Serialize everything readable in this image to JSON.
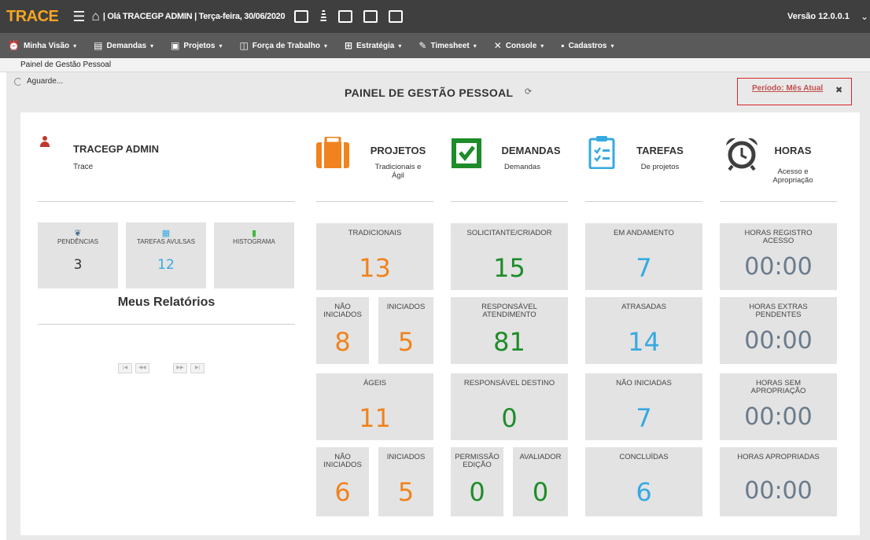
{
  "header": {
    "logo": "TRACE",
    "greeting": "| Olá  TRACEGP ADMIN | Terça-feira, 30/06/2020",
    "version": "Versão 12.0.0.1"
  },
  "nav": {
    "items": [
      {
        "label": "Minha Visão",
        "icon": "clock-icon"
      },
      {
        "label": "Demandas",
        "icon": "document-icon"
      },
      {
        "label": "Projetos",
        "icon": "briefcase-icon"
      },
      {
        "label": "Força de Trabalho",
        "icon": "chart-icon"
      },
      {
        "label": "Estratégia",
        "icon": "hierarchy-icon"
      },
      {
        "label": "Timesheet",
        "icon": "pencil-icon"
      },
      {
        "label": "Console",
        "icon": "tools-icon"
      },
      {
        "label": "Cadastros",
        "icon": "book-icon"
      }
    ]
  },
  "breadcrumb": "Painel de Gestão Pessoal",
  "status": "Aguarde...",
  "page_title": "PAINEL DE GESTÃO PESSOAL",
  "periodo": "Período: Mês Atual",
  "user": {
    "name": "TRACEGP ADMIN",
    "org": "Trace"
  },
  "categories": [
    {
      "title": "PROJETOS",
      "sub1": "Tradicionais e",
      "sub2": "Ágil",
      "color": "#f0831e"
    },
    {
      "title": "DEMANDAS",
      "sub1": "Demandas",
      "sub2": "",
      "color": "#1e8c2a"
    },
    {
      "title": "TAREFAS",
      "sub1": "De projetos",
      "sub2": "",
      "color": "#36a9e1"
    },
    {
      "title": "HORAS",
      "sub1": "Acesso e",
      "sub2": "Apropriação",
      "color": "#3f3f3f"
    }
  ],
  "mini": {
    "pendencias": {
      "label": "PENDÊNCIAS",
      "value": "3"
    },
    "tarefas_avulsas": {
      "label": "TAREFAS AVULSAS",
      "value": "12"
    },
    "histograma": {
      "label": "HISTOGRAMA"
    }
  },
  "relatorios": {
    "title": "Meus Relatórios",
    "pager": [
      "|◀",
      "◀◀",
      "▶▶",
      "▶|"
    ]
  },
  "projetos": {
    "tradicionais": {
      "label": "TRADICIONAIS",
      "value": "13"
    },
    "trad_nao": {
      "label1": "NÃO",
      "label2": "INICIADOS",
      "value": "8"
    },
    "trad_ini": {
      "label": "INICIADOS",
      "value": "5"
    },
    "ageis": {
      "label": "ÁGEIS",
      "value": "11"
    },
    "ag_nao": {
      "label1": "NÃO",
      "label2": "INICIADOS",
      "value": "6"
    },
    "ag_ini": {
      "label": "INICIADOS",
      "value": "5"
    }
  },
  "demandas": {
    "solicitante": {
      "label": "SOLICITANTE/CRIADOR",
      "value": "15"
    },
    "resp_atend": {
      "label1": "RESPONSÁVEL",
      "label2": "ATENDIMENTO",
      "value": "81"
    },
    "resp_dest": {
      "label": "RESPONSÁVEL DESTINO",
      "value": "0"
    },
    "permissao": {
      "label1": "PERMISSÃO",
      "label2": "EDIÇÃO",
      "value": "0"
    },
    "avaliador": {
      "label": "AVALIADOR",
      "value": "0"
    }
  },
  "tarefas": {
    "andamento": {
      "label": "EM ANDAMENTO",
      "value": "7"
    },
    "atrasadas": {
      "label": "ATRASADAS",
      "value": "14"
    },
    "nao_iniciadas": {
      "label": "NÃO INICIADAS",
      "value": "7"
    },
    "concluidas": {
      "label": "CONCLUÍDAS",
      "value": "6"
    }
  },
  "horas": {
    "registro": {
      "label1": "HORAS REGISTRO",
      "label2": "ACESSO",
      "value": "00:00"
    },
    "extras": {
      "label1": "HORAS EXTRAS",
      "label2": "PENDENTES",
      "value": "00:00"
    },
    "sem_aprop": {
      "label1": "HORAS SEM",
      "label2": "APROPRIAÇÃO",
      "value": "00:00"
    },
    "apropriadas": {
      "label": "HORAS APROPRIADAS",
      "value": "00:00"
    }
  }
}
